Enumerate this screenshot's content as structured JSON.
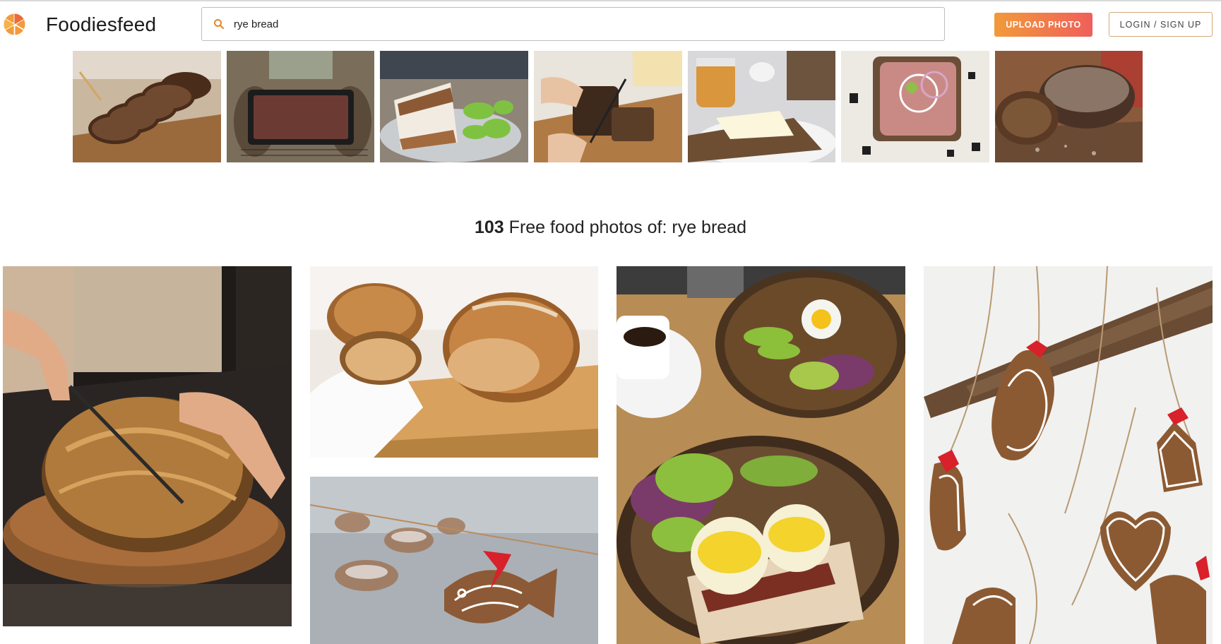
{
  "brand": {
    "name": "Foodiesfeed",
    "logo_icon": "orange-wheel-logo-icon"
  },
  "search": {
    "value": "rye bread",
    "icon": "search-icon"
  },
  "header_buttons": {
    "upload": "UPLOAD PHOTO",
    "login": "LOGIN / SIGN UP"
  },
  "related": {
    "thumbnails": [
      "sliced-rye-loaf-on-board",
      "rye-bread-in-baking-pan",
      "rye-sandwich-with-apples",
      "slicing-dark-rye-loaf",
      "rye-bread-with-honey-and-butter",
      "open-sandwich-roast-beef",
      "rustic-rye-loaf-on-table"
    ]
  },
  "results": {
    "count": "103",
    "label": "Free food photos of: rye bread"
  },
  "grid": {
    "photos": [
      "cutting-sourdough-loaf",
      "sourdough-loaves-on-board",
      "gingerbread-fish-ornament-blurred",
      "eggs-benedict-plates",
      "gingerbread-ornaments-on-strings"
    ]
  },
  "colors": {
    "accent_orange": "#f29a3b",
    "accent_red": "#ef5f5a",
    "login_border": "#d6a878"
  }
}
